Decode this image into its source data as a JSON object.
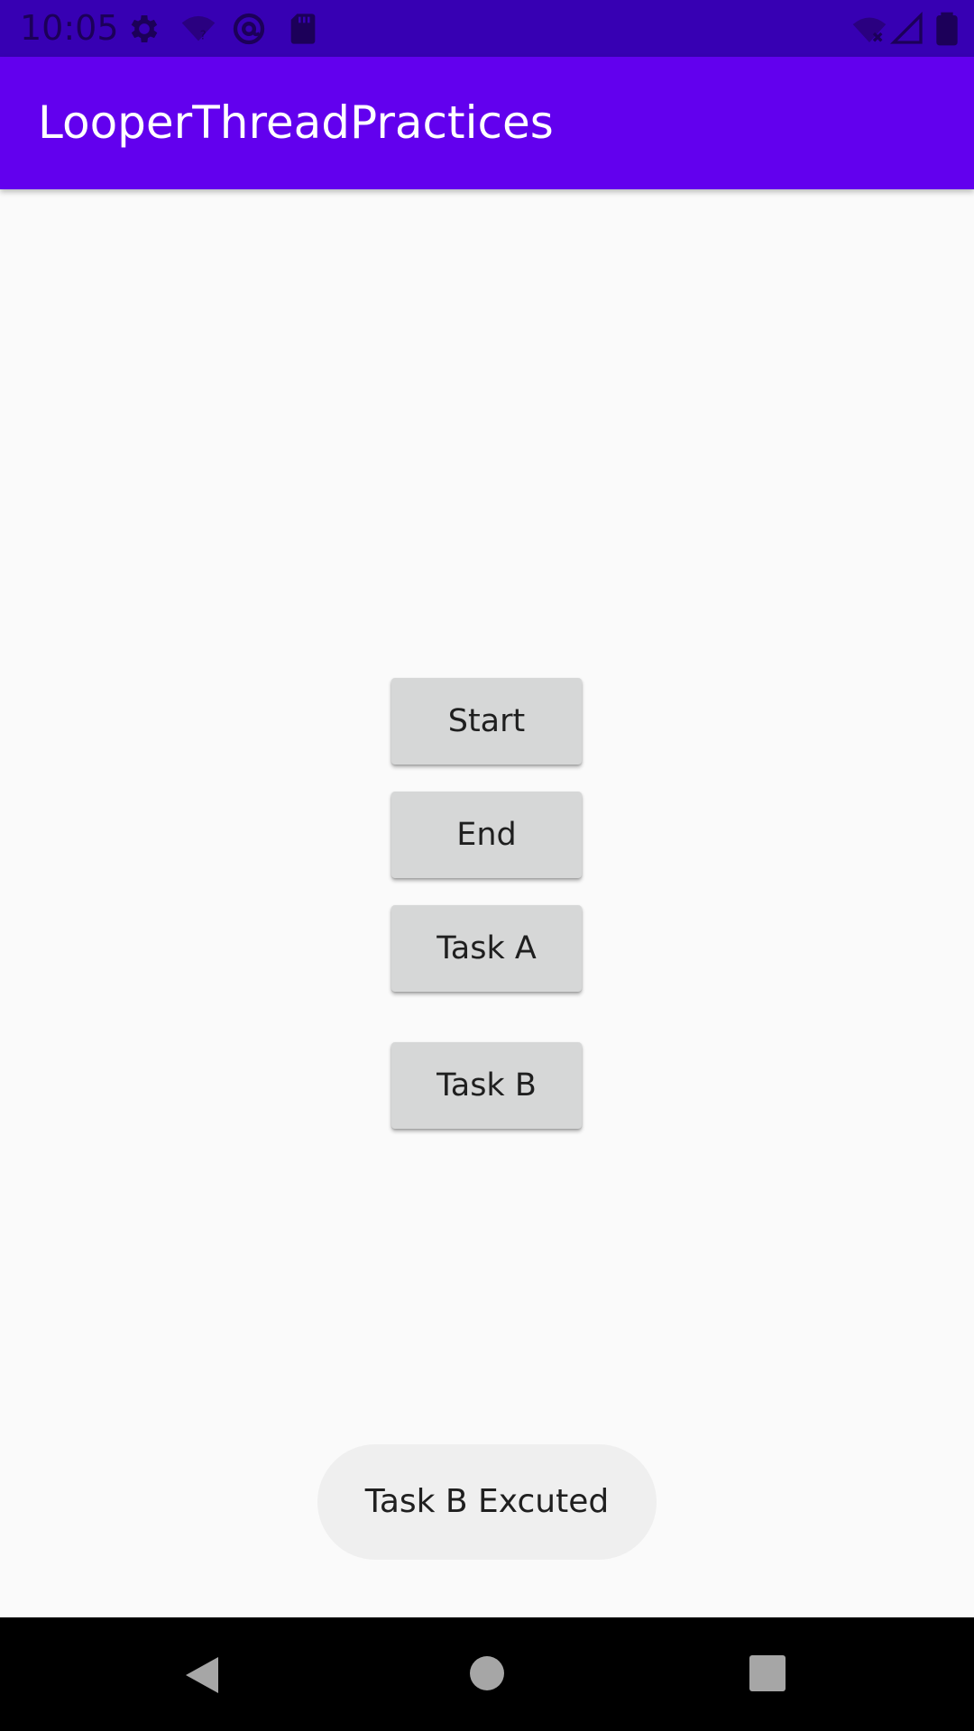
{
  "status_bar": {
    "time": "10:05",
    "background": "#3700b3",
    "icons": [
      "settings-icon",
      "wifi-question-icon",
      "at-sign-icon",
      "sd-card-icon",
      "wifi-off-icon",
      "cell-signal-icon",
      "battery-icon"
    ]
  },
  "app_bar": {
    "title": "LooperThreadPractices",
    "background": "#6200ee"
  },
  "buttons": {
    "start": "Start",
    "end": "End",
    "task_a": "Task A",
    "task_b": "Task B"
  },
  "toast": {
    "message": "Task B Excuted"
  },
  "nav_bar": {
    "icons": [
      "back-icon",
      "home-icon",
      "recents-icon"
    ]
  }
}
